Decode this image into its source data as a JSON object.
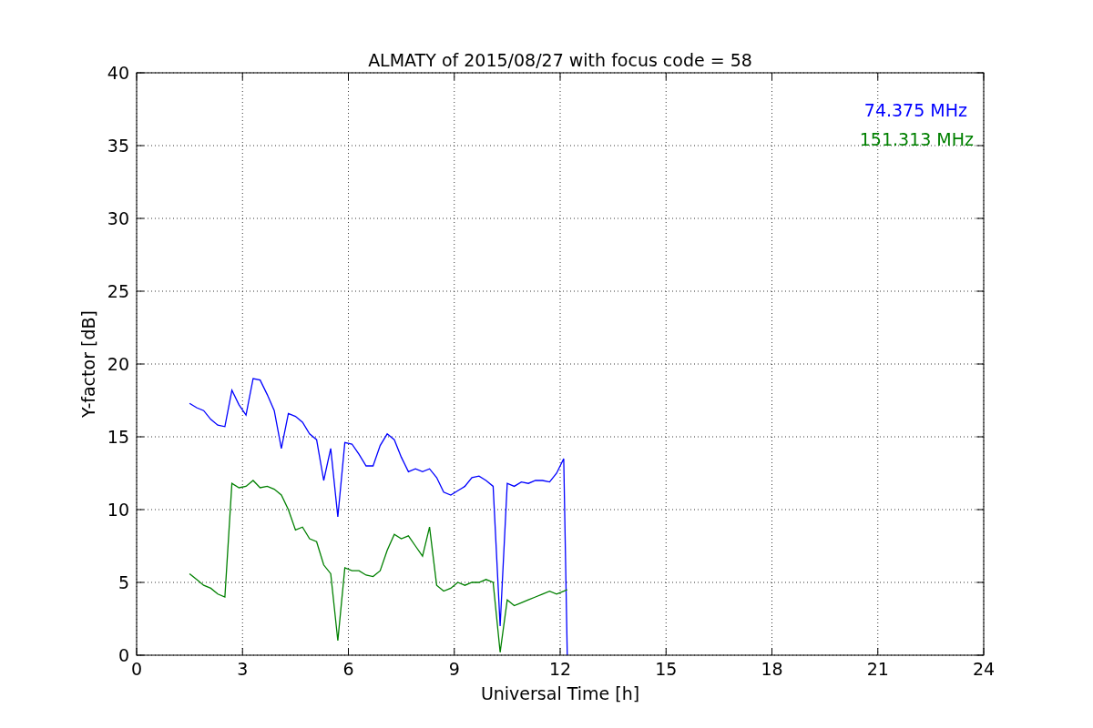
{
  "chart_data": {
    "type": "line",
    "title": "ALMATY of 2015/08/27 with focus code = 58",
    "xlabel": "Universal Time [h]",
    "ylabel": "Y-factor [dB]",
    "x": [
      1.5,
      1.7,
      1.9,
      2.1,
      2.3,
      2.5,
      2.7,
      2.9,
      3.1,
      3.3,
      3.5,
      3.7,
      3.9,
      4.1,
      4.3,
      4.5,
      4.7,
      4.9,
      5.1,
      5.3,
      5.5,
      5.7,
      5.9,
      6.1,
      6.3,
      6.5,
      6.7,
      6.9,
      7.1,
      7.3,
      7.5,
      7.7,
      7.9,
      8.1,
      8.3,
      8.5,
      8.7,
      8.9,
      9.1,
      9.3,
      9.5,
      9.7,
      9.9,
      10.1,
      10.3,
      10.5,
      10.7,
      10.9,
      11.1,
      11.3,
      11.5,
      11.7,
      11.9,
      12.1,
      12.2
    ],
    "series": [
      {
        "name": "74.375 MHz",
        "color": "#0000ff",
        "values": [
          17.3,
          17.0,
          16.8,
          16.2,
          15.8,
          15.7,
          18.2,
          17.2,
          16.5,
          19.0,
          18.9,
          17.9,
          16.8,
          14.2,
          16.6,
          16.4,
          16.0,
          15.2,
          14.8,
          12.0,
          14.2,
          9.5,
          14.6,
          14.5,
          13.8,
          13.0,
          13.0,
          14.4,
          15.2,
          14.8,
          13.6,
          12.6,
          12.8,
          12.6,
          12.8,
          12.2,
          11.2,
          11.0,
          11.3,
          11.6,
          12.2,
          12.3,
          12.0,
          11.6,
          2.0,
          11.8,
          11.6,
          11.9,
          11.8,
          12.0,
          12.0,
          11.9,
          12.5,
          13.5,
          0
        ]
      },
      {
        "name": "151.313 MHz",
        "color": "#008000",
        "values": [
          5.6,
          5.2,
          4.8,
          4.6,
          4.2,
          4.0,
          11.8,
          11.5,
          11.6,
          12.0,
          11.5,
          11.6,
          11.4,
          11.0,
          10.0,
          8.6,
          8.8,
          8.0,
          7.8,
          6.2,
          5.6,
          1.0,
          6.0,
          5.8,
          5.8,
          5.5,
          5.4,
          5.8,
          7.2,
          8.3,
          8.0,
          8.2,
          7.5,
          6.8,
          8.8,
          4.8,
          4.4,
          4.6,
          5.0,
          4.8,
          5.0,
          5.0,
          5.2,
          5.0,
          0.2,
          3.8,
          3.4,
          3.6,
          3.8,
          4.0,
          4.2,
          4.4,
          4.2,
          4.4,
          4.5
        ]
      }
    ],
    "xlim": [
      0,
      24
    ],
    "ylim": [
      0,
      40
    ],
    "xticks": [
      0,
      3,
      6,
      9,
      12,
      15,
      18,
      21,
      24
    ],
    "yticks": [
      0,
      5,
      10,
      15,
      20,
      25,
      30,
      35,
      40
    ],
    "grid": true
  }
}
